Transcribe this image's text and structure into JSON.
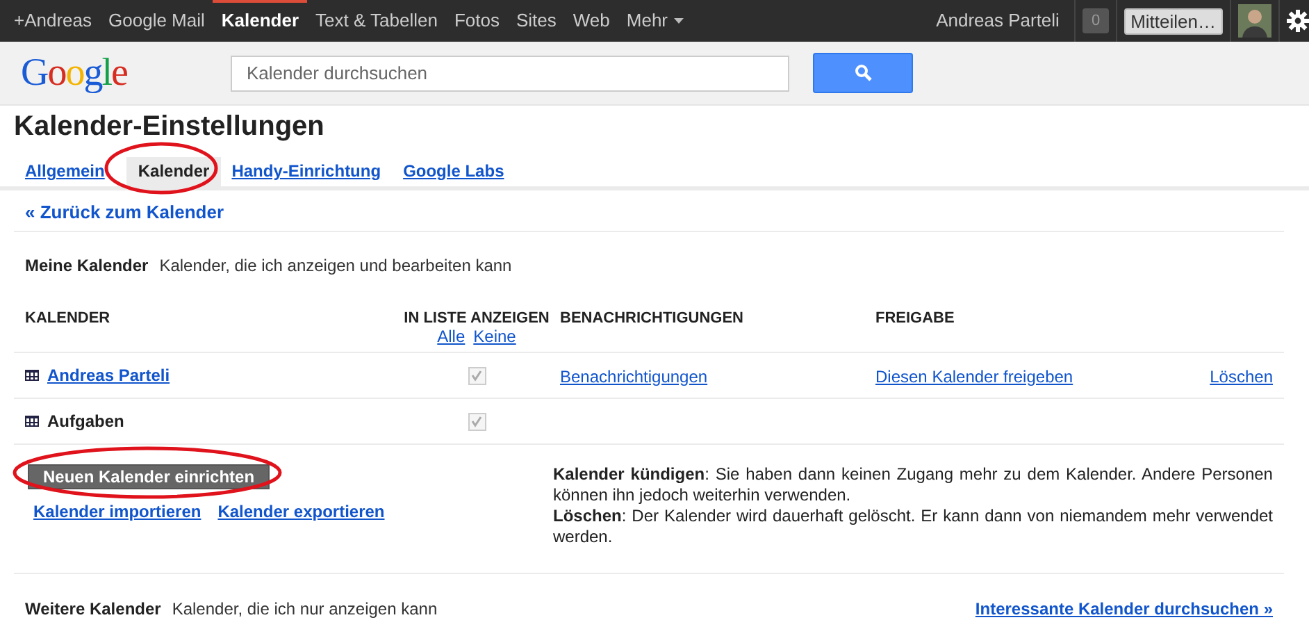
{
  "topbar": {
    "links": [
      {
        "label": "+Andreas",
        "selected": false
      },
      {
        "label": "Google Mail",
        "selected": false
      },
      {
        "label": "Kalender",
        "selected": true
      },
      {
        "label": "Text & Tabellen",
        "selected": false
      },
      {
        "label": "Fotos",
        "selected": false
      },
      {
        "label": "Sites",
        "selected": false
      },
      {
        "label": "Web",
        "selected": false
      },
      {
        "label": "Mehr",
        "selected": false
      }
    ],
    "user": "Andreas Parteli",
    "notification_count": "0",
    "share_button": "Mitteilen…"
  },
  "header": {
    "logo": "Google",
    "search": {
      "placeholder": "Kalender durchsuchen"
    }
  },
  "page_title": "Kalender-Einstellungen",
  "tabs": [
    {
      "label": "Allgemein",
      "selected": false
    },
    {
      "label": "Kalender",
      "selected": true
    },
    {
      "label": "Handy-Einrichtung",
      "selected": false
    },
    {
      "label": "Google Labs",
      "selected": false
    }
  ],
  "back_link": "« Zurück zum Kalender",
  "my_calendars": {
    "heading": "Meine Kalender",
    "description": "Kalender, die ich anzeigen und bearbeiten kann",
    "columns": {
      "calendar": "KALENDER",
      "show_in_list": "IN LISTE ANZEIGEN",
      "all": "Alle",
      "none": "Keine",
      "notifications": "BENACHRICHTIGUNGEN",
      "sharing": "FREIGABE"
    },
    "rows": [
      {
        "name": "Andreas Parteli",
        "kind": "link",
        "checked": true,
        "notifications": "Benachrichtigungen",
        "sharing": "Diesen Kalender freigeben",
        "delete": "Löschen"
      },
      {
        "name": "Aufgaben",
        "kind": "plain",
        "checked": true
      }
    ],
    "new_button": "Neuen Kalender einrichten",
    "import_link": "Kalender importieren",
    "export_link": "Kalender exportieren",
    "notes": [
      "**Kalender kündigen**: Sie haben dann keinen Zugang mehr zu dem Kalender. Andere Personen können ihn jedoch weiterhin verwenden.",
      "**Löschen**: Der Kalender wird dauerhaft gelöscht. Er kann dann von niemandem mehr verwendet werden."
    ]
  },
  "other_calendars": {
    "heading": "Weitere Kalender",
    "description": "Kalender, die ich nur anzeigen kann",
    "browse_link": "Interessante Kalender durchsuchen »"
  }
}
